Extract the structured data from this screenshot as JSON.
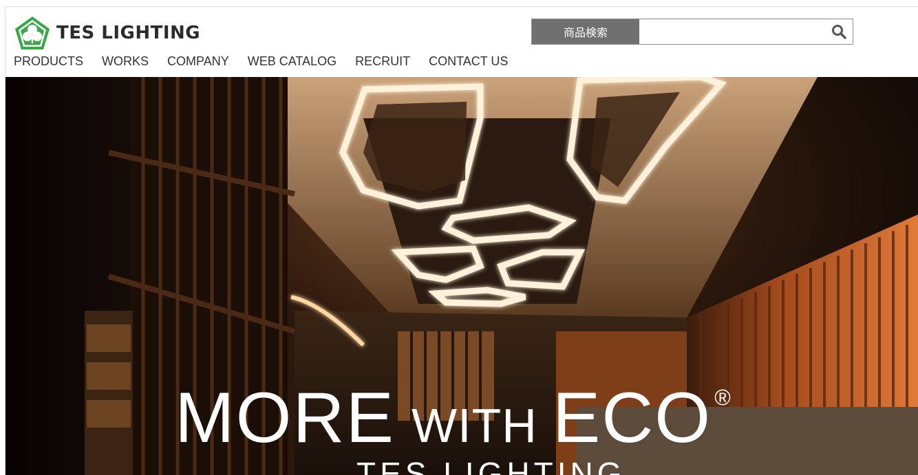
{
  "header": {
    "brand_name": "TES LIGHTING",
    "search": {
      "label": "商品検索",
      "placeholder": "",
      "value": "",
      "button_icon": "magnifier-icon"
    },
    "nav": [
      {
        "label": "PRODUCTS"
      },
      {
        "label": "WORKS"
      },
      {
        "label": "COMPANY"
      },
      {
        "label": "WEB CATALOG"
      },
      {
        "label": "RECRUIT"
      },
      {
        "label": "CONTACT US"
      }
    ]
  },
  "hero": {
    "headline_more": "MORE",
    "headline_with": "WITH",
    "headline_eco": "ECO",
    "registered_mark": "®",
    "subheadline": "TES LIGHTING"
  },
  "colors": {
    "brand_green": "#3aa84a",
    "search_label_bg": "#707070",
    "nav_text": "#333333",
    "hero_glow": "#ffb46a"
  }
}
